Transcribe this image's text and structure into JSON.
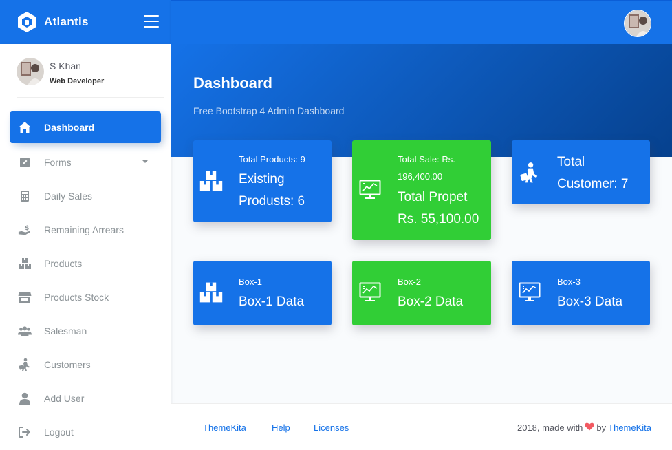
{
  "app": {
    "name": "Atlantis"
  },
  "user": {
    "name": "S Khan",
    "role": "Web Developer"
  },
  "sidebar": {
    "items": [
      {
        "label": "Dashboard",
        "icon": "home-icon",
        "active": true
      },
      {
        "label": "Forms",
        "icon": "pen-square-icon",
        "has_caret": true
      },
      {
        "label": "Daily Sales",
        "icon": "calculator-icon"
      },
      {
        "label": "Remaining Arrears",
        "icon": "hand-dollar-icon"
      },
      {
        "label": "Products",
        "icon": "boxes-icon"
      },
      {
        "label": "Products Stock",
        "icon": "store-icon"
      },
      {
        "label": "Salesman",
        "icon": "users-icon"
      },
      {
        "label": "Customers",
        "icon": "person-luggage-icon"
      },
      {
        "label": "Add User",
        "icon": "user-icon"
      },
      {
        "label": "Logout",
        "icon": "logout-icon"
      }
    ]
  },
  "header": {
    "title": "Dashboard",
    "subtitle": "Free Bootstrap 4 Admin Dashboard"
  },
  "cards": {
    "products": {
      "line1": "Total Products: 9",
      "line2": "Existing",
      "line3": "Produsts: 6",
      "icon": "boxes-icon",
      "color": "#1572e8"
    },
    "sale": {
      "line1": "Total Sale: Rs.",
      "line2": "196,400.00",
      "line3": "Total Propet",
      "line4": "Rs. 55,100.00",
      "icon": "chart-monitor-icon",
      "color": "#31ce36"
    },
    "customer": {
      "line1": "Total",
      "line2": "Customer: 7",
      "icon": "person-luggage-icon",
      "color": "#1572e8"
    },
    "box1": {
      "label": "Box-1",
      "value": "Box-1 Data",
      "icon": "boxes-icon",
      "color": "#1572e8"
    },
    "box2": {
      "label": "Box-2",
      "value": "Box-2 Data",
      "icon": "chart-monitor-icon",
      "color": "#31ce36"
    },
    "box3": {
      "label": "Box-3",
      "value": "Box-3 Data",
      "icon": "chart-monitor-icon",
      "color": "#1572e8"
    }
  },
  "footer": {
    "links": [
      "ThemeKita",
      "Help",
      "Licenses"
    ],
    "copyright_prefix": "2018, made with",
    "copyright_by": "by",
    "copyright_brand": "ThemeKita"
  }
}
